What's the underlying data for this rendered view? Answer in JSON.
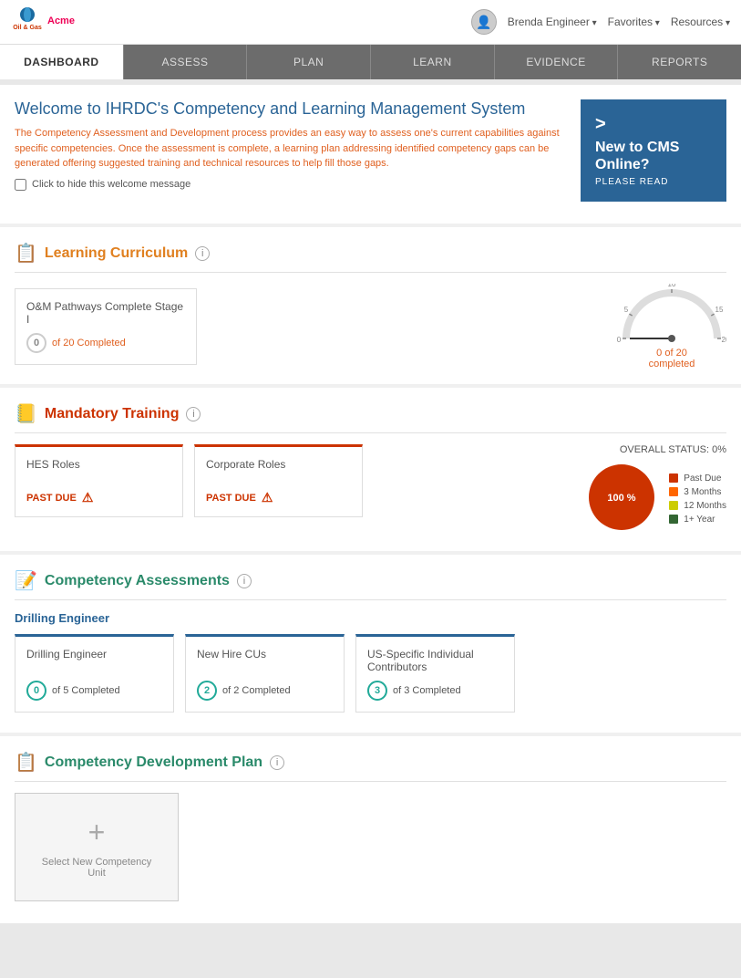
{
  "header": {
    "logo_name": "Acme",
    "logo_sub": "Oil & Gas",
    "user_name": "Brenda Engineer",
    "favorites_label": "Favorites",
    "resources_label": "Resources"
  },
  "nav": {
    "tabs": [
      {
        "label": "DASHBOARD",
        "active": true
      },
      {
        "label": "ASSESS",
        "active": false
      },
      {
        "label": "PLAN",
        "active": false
      },
      {
        "label": "LEARN",
        "active": false
      },
      {
        "label": "EVIDENCE",
        "active": false
      },
      {
        "label": "REPORTS",
        "active": false
      }
    ]
  },
  "welcome": {
    "title": "Welcome to IHRDC's Competency and Learning Management System",
    "description": "The Competency Assessment and Development process provides an easy way to assess one's current capabilities against specific competencies. Once the assessment is complete, a learning plan addressing identified competency gaps can be generated offering suggested training and technical resources to help fill those gaps.",
    "hide_label": "Click to hide this welcome message",
    "cms_banner_arrow": ">",
    "cms_banner_title": "New to CMS Online?",
    "cms_banner_sub": "PLEASE READ"
  },
  "learning_curriculum": {
    "section_title": "Learning Curriculum",
    "card": {
      "title": "O&M Pathways Complete Stage I",
      "completed_count": "0",
      "total": "20",
      "completed_label": "of 20 Completed"
    },
    "gauge": {
      "label": "0 of 20",
      "sub_label": "completed",
      "max": 20,
      "current": 0,
      "ticks": [
        "0",
        "5",
        "10",
        "15",
        "20"
      ]
    }
  },
  "mandatory_training": {
    "section_title": "Mandatory Training",
    "overall_status_label": "OVERALL STATUS: 0%",
    "cards": [
      {
        "title": "HES Roles",
        "status": "PAST DUE"
      },
      {
        "title": "Corporate Roles",
        "status": "PAST DUE"
      }
    ],
    "chart": {
      "percent": "100 %",
      "legend": [
        {
          "label": "Past Due",
          "color": "#cc3300"
        },
        {
          "label": "3 Months",
          "color": "#ff6600"
        },
        {
          "label": "12 Months",
          "color": "#cccc00"
        },
        {
          "label": "1+ Year",
          "color": "#336633"
        }
      ]
    }
  },
  "competency_assessments": {
    "section_title": "Competency Assessments",
    "role_title": "Drilling Engineer",
    "cards": [
      {
        "title": "Drilling Engineer",
        "completed": "0",
        "total": "5",
        "label": "of 5 Completed"
      },
      {
        "title": "New Hire CUs",
        "completed": "2",
        "total": "2",
        "label": "of 2 Completed"
      },
      {
        "title": "US-Specific Individual Contributors",
        "completed": "3",
        "total": "3",
        "label": "of 3 Completed"
      }
    ]
  },
  "competency_dev_plan": {
    "section_title": "Competency Development Plan",
    "add_label": "Select New Competency Unit"
  }
}
